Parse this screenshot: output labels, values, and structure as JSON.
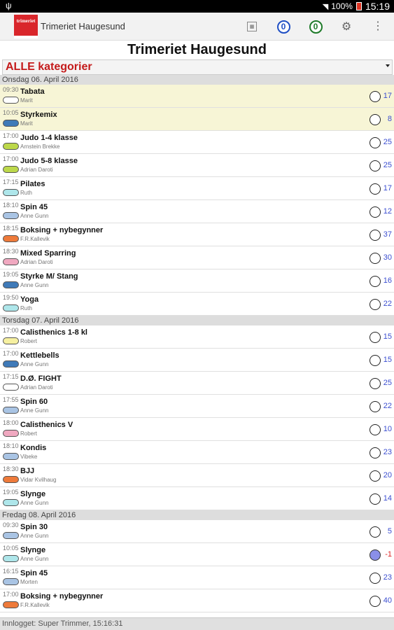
{
  "statusbar": {
    "battery": "100%",
    "time": "15:19",
    "icons": [
      "usb-icon",
      "wifi-icon",
      "battery-icon"
    ]
  },
  "actionbar": {
    "logo_text": "trimeriet",
    "title": "Trimeriet Haugesund",
    "badge_blue": "0",
    "badge_green": "0",
    "icons": [
      "calendar-icon",
      "gear-icon",
      "overflow-menu-icon"
    ]
  },
  "page_title": "Trimeriet Haugesund",
  "category": {
    "selected": "ALLE kategorier"
  },
  "days": [
    {
      "label": "Onsdag 06. April 2016",
      "classes": [
        {
          "time": "09:30",
          "name": "Tabata",
          "instructor": "Marit",
          "color": "#ffffff",
          "count": "17",
          "highlight": true
        },
        {
          "time": "10:05",
          "name": "Styrkemix",
          "instructor": "Marit",
          "color": "#3f7ab8",
          "count": "8",
          "highlight": true
        },
        {
          "time": "17:00",
          "name": "Judo 1-4 klasse",
          "instructor": "Arnstein Brekke",
          "color": "#bcd84a",
          "count": "25"
        },
        {
          "time": "17:00",
          "name": "Judo 5-8 klasse",
          "instructor": "Adrian Daroti",
          "color": "#bcd84a",
          "count": "25"
        },
        {
          "time": "17:15",
          "name": "Pilates",
          "instructor": "Ruth",
          "color": "#aee6ea",
          "count": "17"
        },
        {
          "time": "18:10",
          "name": "Spin 45",
          "instructor": "Anne Gunn",
          "color": "#a9c4e4",
          "count": "12"
        },
        {
          "time": "18:15",
          "name": "Boksing + nybegynner",
          "instructor": "F.R.Kallevik",
          "color": "#ee7a3a",
          "count": "37"
        },
        {
          "time": "18:30",
          "name": "Mixed Sparring",
          "instructor": "Adrian Daroti",
          "color": "#f0a8c0",
          "count": "30"
        },
        {
          "time": "19:05",
          "name": "Styrke M/ Stang",
          "instructor": "Anne Gunn",
          "color": "#3f7ab8",
          "count": "16"
        },
        {
          "time": "19:50",
          "name": "Yoga",
          "instructor": "Ruth",
          "color": "#aee6ea",
          "count": "22"
        }
      ]
    },
    {
      "label": "Torsdag 07. April 2016",
      "classes": [
        {
          "time": "17:00",
          "name": "Calisthenics 1-8 kl",
          "instructor": "Robert",
          "color": "#f6f0a0",
          "count": "15"
        },
        {
          "time": "17:00",
          "name": "Kettlebells",
          "instructor": "Anne Gunn",
          "color": "#3f7ab8",
          "count": "15"
        },
        {
          "time": "17:15",
          "name": "D.Ø. FIGHT",
          "instructor": "Adrian Daroti",
          "color": "#ffffff",
          "count": "25"
        },
        {
          "time": "17:55",
          "name": "Spin 60",
          "instructor": "Anne Gunn",
          "color": "#a9c4e4",
          "count": "22"
        },
        {
          "time": "18:00",
          "name": "Calisthenics V",
          "instructor": "Robert",
          "color": "#f0a8c0",
          "count": "10"
        },
        {
          "time": "18:10",
          "name": "Kondis",
          "instructor": "Vibeke",
          "color": "#a9c4e4",
          "count": "23"
        },
        {
          "time": "18:30",
          "name": "BJJ",
          "instructor": "Vidar Kvilhaug",
          "color": "#ee7a3a",
          "count": "20"
        },
        {
          "time": "19:05",
          "name": "Slynge",
          "instructor": "Anne Gunn",
          "color": "#aee6ea",
          "count": "14"
        }
      ]
    },
    {
      "label": "Fredag 08. April 2016",
      "classes": [
        {
          "time": "09:30",
          "name": "Spin 30",
          "instructor": "Anne Gunn",
          "color": "#a9c4e4",
          "count": "5"
        },
        {
          "time": "10:05",
          "name": "Slynge",
          "instructor": "Anne Gunn",
          "color": "#aee6ea",
          "count": "-1",
          "filled": true
        },
        {
          "time": "16:15",
          "name": "Spin 45",
          "instructor": "Morten",
          "color": "#a9c4e4",
          "count": "23"
        },
        {
          "time": "17:00",
          "name": "Boksing + nybegynner",
          "instructor": "F.R.Kallevik",
          "color": "#ee7a3a",
          "count": "40"
        }
      ]
    }
  ],
  "footer": {
    "text": "Innlogget: Super Trimmer, 15:16:31"
  }
}
